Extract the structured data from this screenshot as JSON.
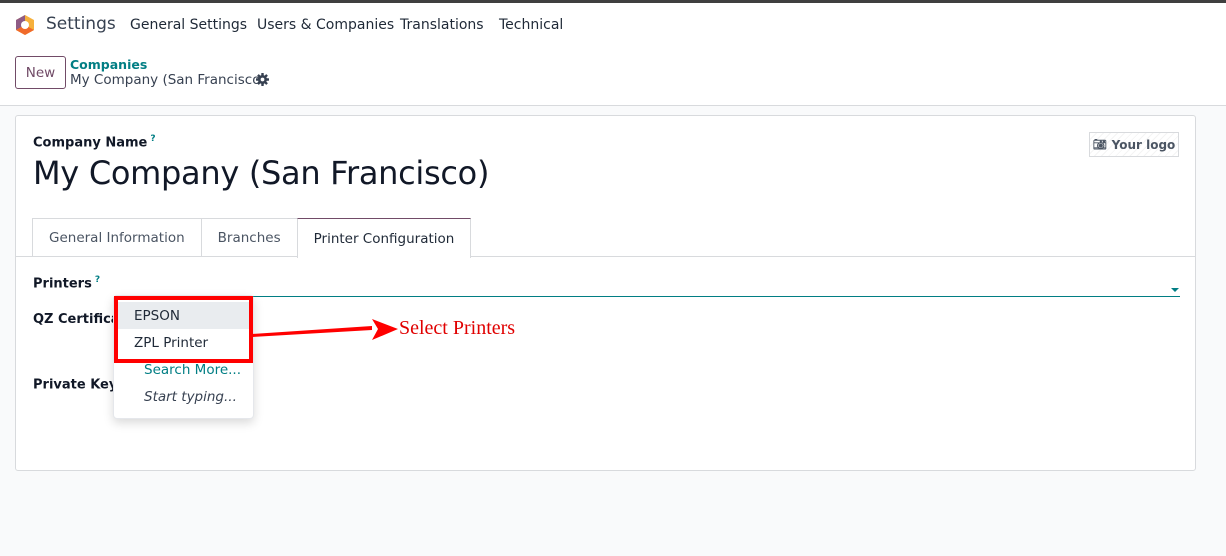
{
  "navbar": {
    "app_name": "Settings",
    "menu": [
      "General Settings",
      "Users & Companies",
      "Translations",
      "Technical"
    ],
    "logo_colors": {
      "left": "#714b67",
      "right": "#f6b03c",
      "bottom": "#f06a2a"
    }
  },
  "control_panel": {
    "new_button": "New",
    "breadcrumb_parent": "Companies",
    "breadcrumb_current": "My Company (San Francisco)"
  },
  "form": {
    "company_name_label": "Company Name",
    "help_mark": "?",
    "company_name": "My Company (San Francisco)",
    "logo_button": "Your logo",
    "tabs": [
      {
        "label": "General Information",
        "active": false
      },
      {
        "label": "Branches",
        "active": false
      },
      {
        "label": "Printer Configuration",
        "active": true
      }
    ],
    "fields": {
      "printers_label": "Printers",
      "printers_value": "",
      "qz_certificate_label": "QZ Certificate",
      "private_key_label": "Private Key"
    }
  },
  "dropdown": {
    "options": [
      "EPSON",
      "ZPL Printer"
    ],
    "highlighted": "EPSON",
    "search_more": "Search More...",
    "start_typing": "Start typing..."
  },
  "annotation": {
    "text": "Select Printers",
    "color": "#ff0000"
  },
  "colors": {
    "primary": "#714b67",
    "accent": "#017e84"
  }
}
